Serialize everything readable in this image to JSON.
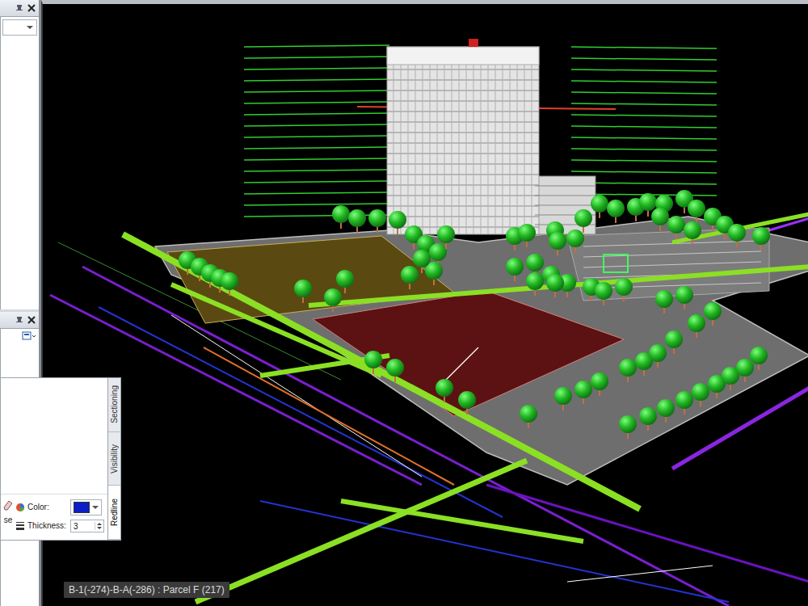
{
  "redline": {
    "tabs": [
      {
        "label": "Sectioning",
        "selected": false
      },
      {
        "label": "Visibility",
        "selected": false
      },
      {
        "label": "Redline",
        "selected": true
      }
    ],
    "erase_label": "se",
    "color": {
      "label": "Color:",
      "swatch": "#0b1ec8"
    },
    "thickness": {
      "label": "Thickness:",
      "value": "3"
    }
  },
  "status_bar": "B-1(-274)-B-A(-286) : Parcel F (217)"
}
